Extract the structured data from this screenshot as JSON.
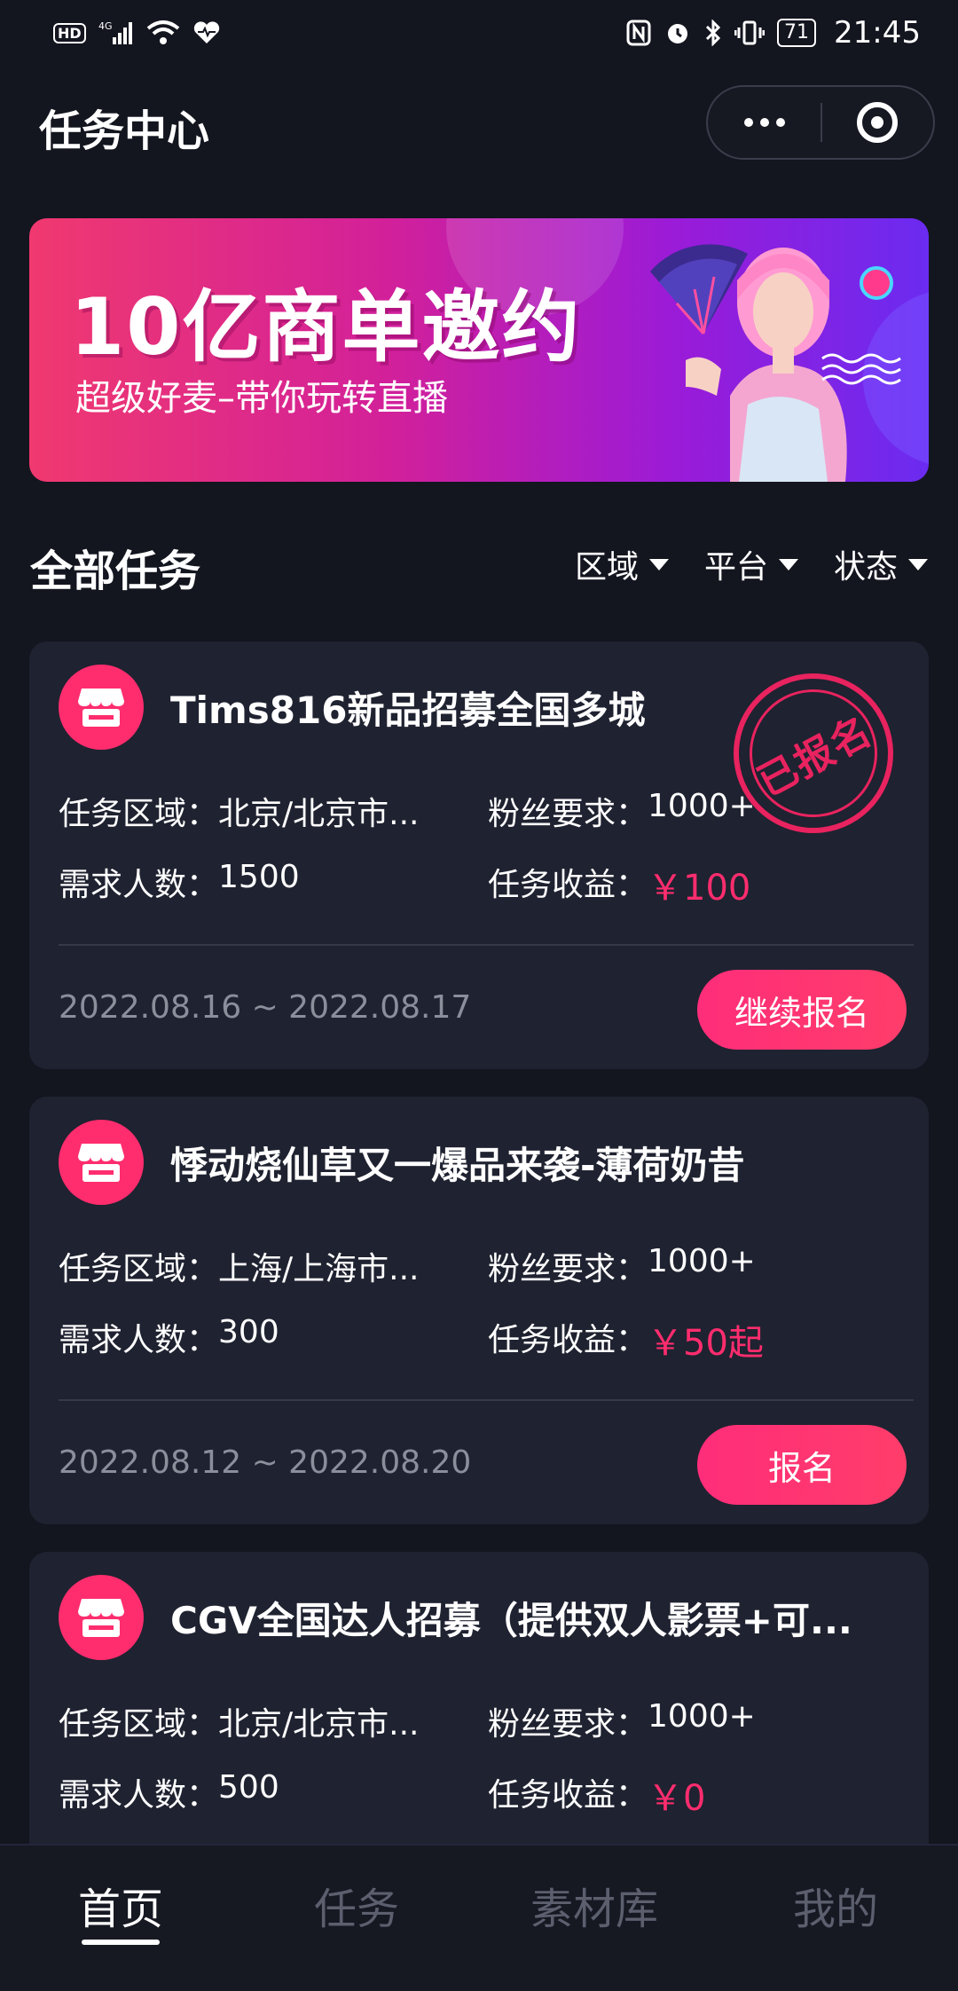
{
  "status_bar": {
    "hd": "HD",
    "network": "4G",
    "battery": "71",
    "time": "21:45"
  },
  "header": {
    "title": "任务中心"
  },
  "banner": {
    "title": "10亿商单邀约",
    "subtitle": "超级好麦–带你玩转直播"
  },
  "section": {
    "title": "全部任务",
    "filters": [
      "区域",
      "平台",
      "状态"
    ]
  },
  "labels": {
    "region": "任务区域：",
    "fans": "粉丝要求：",
    "headcount": "需求人数：",
    "reward": "任务收益："
  },
  "tasks": [
    {
      "title": "Tims816新品招募全国多城",
      "region": "北京/北京市...",
      "fans": "1000+",
      "headcount": "1500",
      "reward": "￥100",
      "date": "2022.08.16 ~ 2022.08.17",
      "action": "继续报名",
      "stamp": "已报名"
    },
    {
      "title": "悸动烧仙草又一爆品来袭-薄荷奶昔",
      "region": "上海/上海市...",
      "fans": "1000+",
      "headcount": "300",
      "reward": "￥50起",
      "date": "2022.08.12 ~ 2022.08.20",
      "action": "报名"
    },
    {
      "title": "CGV全国达人招募（提供双人影票+可...",
      "region": "北京/北京市...",
      "fans": "1000+",
      "headcount": "500",
      "reward": "￥0"
    }
  ],
  "tabbar": {
    "items": [
      "首页",
      "任务",
      "素材库",
      "我的"
    ],
    "active": "首页"
  },
  "colors": {
    "background": "#13151f",
    "card": "#1f2230",
    "accent": "#ff2d6e",
    "muted": "#8b8f9c"
  }
}
